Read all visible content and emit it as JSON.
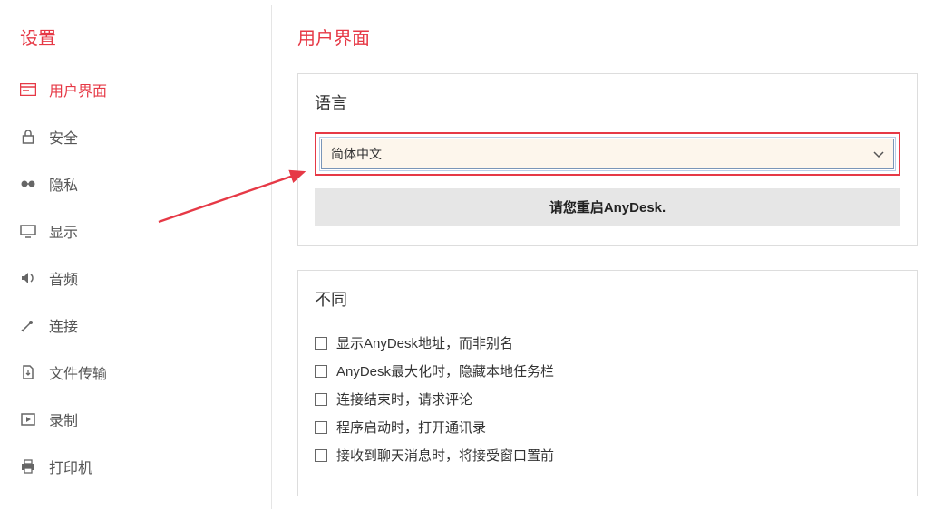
{
  "sidebar": {
    "title": "设置",
    "items": [
      {
        "label": "用户界面",
        "icon": "ui"
      },
      {
        "label": "安全",
        "icon": "lock"
      },
      {
        "label": "隐私",
        "icon": "privacy"
      },
      {
        "label": "显示",
        "icon": "monitor"
      },
      {
        "label": "音频",
        "icon": "speaker"
      },
      {
        "label": "连接",
        "icon": "connection"
      },
      {
        "label": "文件传输",
        "icon": "file"
      },
      {
        "label": "录制",
        "icon": "record"
      },
      {
        "label": "打印机",
        "icon": "printer"
      }
    ]
  },
  "main": {
    "title": "用户界面",
    "language_section": {
      "heading": "语言",
      "selected": "简体中文",
      "restart_notice": "请您重启AnyDesk."
    },
    "misc_section": {
      "heading": "不同",
      "options": [
        "显示AnyDesk地址，而非别名",
        "AnyDesk最大化时，隐藏本地任务栏",
        "连接结束时，请求评论",
        "程序启动时，打开通讯录",
        "接收到聊天消息时，将接受窗口置前"
      ]
    }
  },
  "colors": {
    "accent": "#e63946"
  }
}
